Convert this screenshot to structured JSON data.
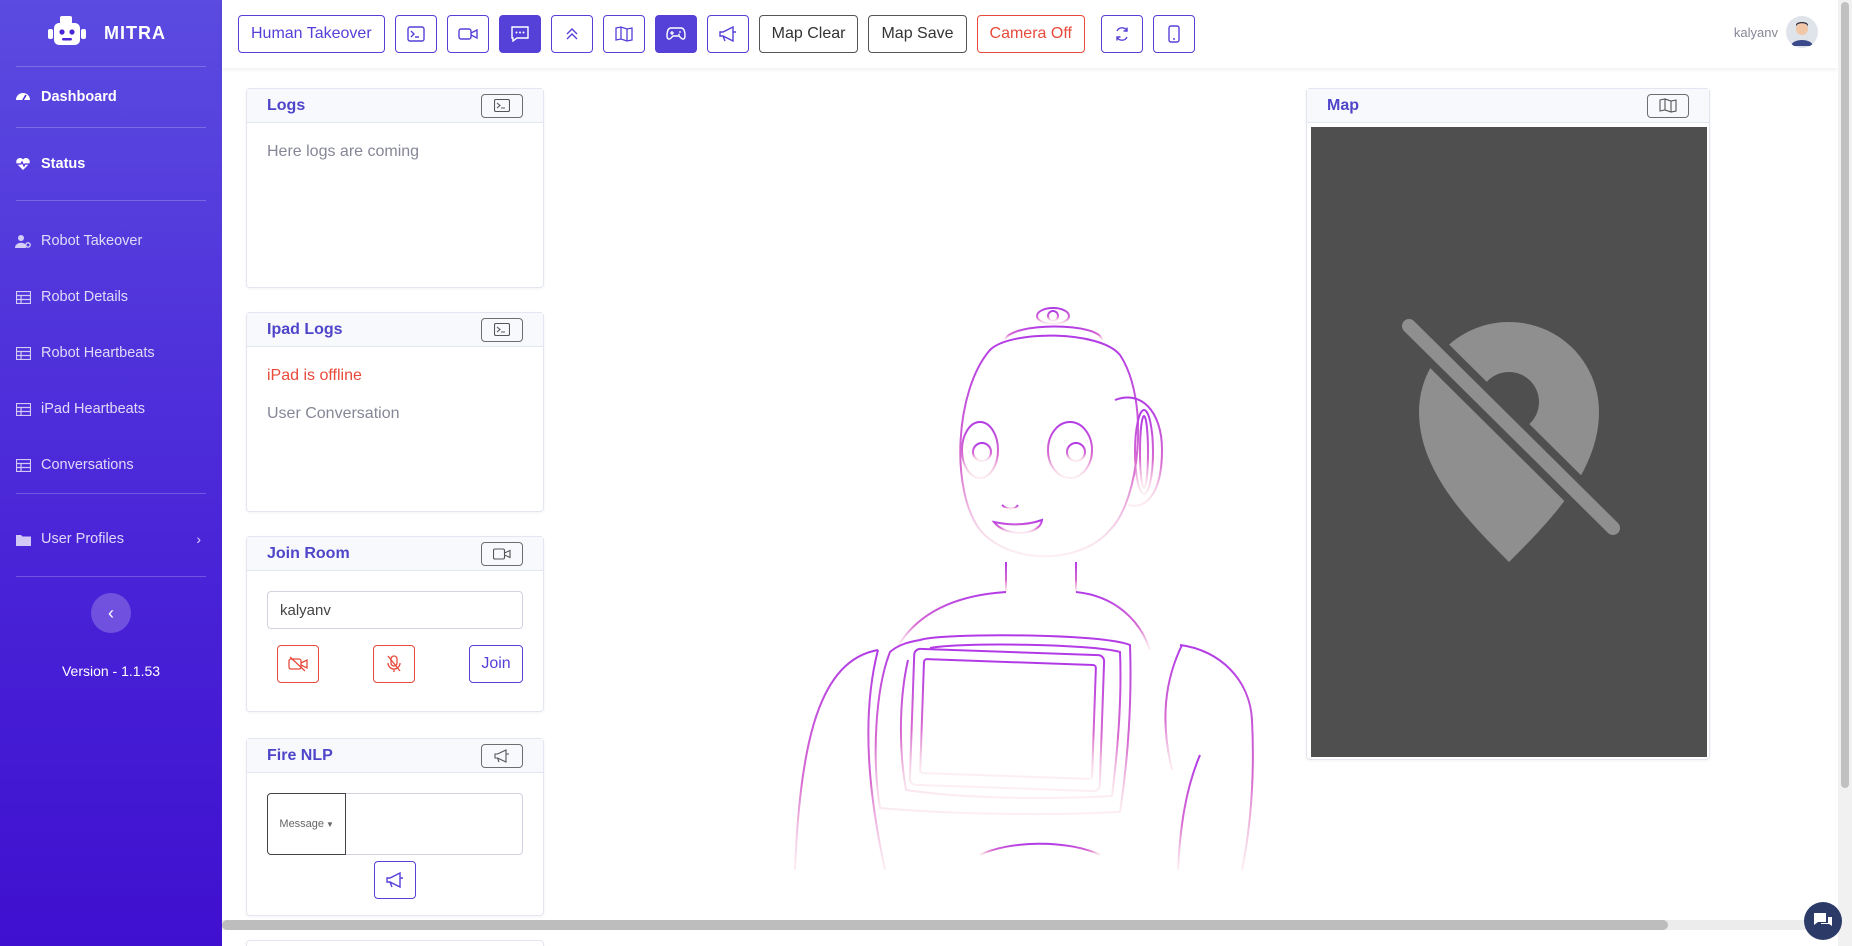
{
  "sidebar": {
    "brand": "MITRA",
    "items": [
      {
        "label": "Dashboard",
        "icon": "dashboard-gauge-icon"
      },
      {
        "label": "Status",
        "icon": "heartbeat-icon"
      },
      {
        "label": "Robot Takeover",
        "icon": "user-cog-icon"
      },
      {
        "label": "Robot Details",
        "icon": "table-icon"
      },
      {
        "label": "Robot Heartbeats",
        "icon": "table-icon"
      },
      {
        "label": "iPad Heartbeats",
        "icon": "table-icon"
      },
      {
        "label": "Conversations",
        "icon": "table-icon"
      },
      {
        "label": "User Profiles",
        "icon": "folder-icon"
      }
    ],
    "version": "Version - 1.1.53"
  },
  "toolbar": {
    "human_takeover": "Human Takeover",
    "map_clear": "Map Clear",
    "map_save": "Map Save",
    "camera_off": "Camera Off",
    "accent": "#5540d8",
    "danger": "#e74a3b"
  },
  "user": {
    "name": "kalyanv"
  },
  "logs": {
    "title": "Logs",
    "text": "Here logs are coming"
  },
  "ipad_logs": {
    "title": "Ipad Logs",
    "status": "iPad is offline",
    "conversation": "User Conversation"
  },
  "join_room": {
    "title": "Join Room",
    "input_value": "kalyanv",
    "join_label": "Join"
  },
  "fire_nlp": {
    "title": "Fire NLP",
    "select_label": "Message"
  },
  "map": {
    "title": "Map",
    "icon": "map-off-icon"
  }
}
